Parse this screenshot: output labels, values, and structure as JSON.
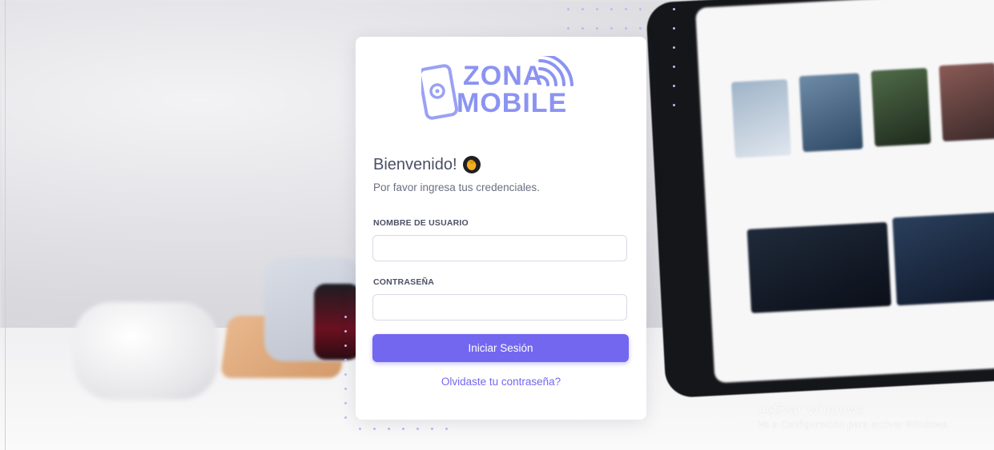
{
  "brand": {
    "line1": "ZONA",
    "line2": "MOBILE",
    "color": "#8b93f2"
  },
  "login": {
    "greeting": "Bienvenido!",
    "subtitle": "Por favor ingresa tus credenciales.",
    "username_label": "NOMBRE DE USUARIO",
    "username_value": "",
    "password_label": "CONTRASEÑA",
    "password_value": "",
    "submit_label": "Iniciar Sesión",
    "forgot_label": "Olvidaste tu contraseña?",
    "accent": "#7367f0"
  },
  "watermark": {
    "title": "Activar Windows",
    "subtitle": "Ve a Configuración para activar Windows."
  }
}
